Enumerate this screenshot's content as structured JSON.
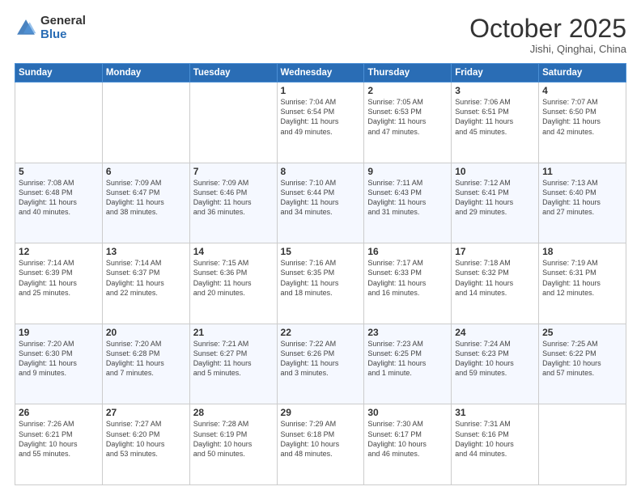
{
  "logo": {
    "general": "General",
    "blue": "Blue"
  },
  "header": {
    "month": "October 2025",
    "location": "Jishi, Qinghai, China"
  },
  "days_of_week": [
    "Sunday",
    "Monday",
    "Tuesday",
    "Wednesday",
    "Thursday",
    "Friday",
    "Saturday"
  ],
  "weeks": [
    [
      {
        "day": "",
        "info": ""
      },
      {
        "day": "",
        "info": ""
      },
      {
        "day": "",
        "info": ""
      },
      {
        "day": "1",
        "info": "Sunrise: 7:04 AM\nSunset: 6:54 PM\nDaylight: 11 hours\nand 49 minutes."
      },
      {
        "day": "2",
        "info": "Sunrise: 7:05 AM\nSunset: 6:53 PM\nDaylight: 11 hours\nand 47 minutes."
      },
      {
        "day": "3",
        "info": "Sunrise: 7:06 AM\nSunset: 6:51 PM\nDaylight: 11 hours\nand 45 minutes."
      },
      {
        "day": "4",
        "info": "Sunrise: 7:07 AM\nSunset: 6:50 PM\nDaylight: 11 hours\nand 42 minutes."
      }
    ],
    [
      {
        "day": "5",
        "info": "Sunrise: 7:08 AM\nSunset: 6:48 PM\nDaylight: 11 hours\nand 40 minutes."
      },
      {
        "day": "6",
        "info": "Sunrise: 7:09 AM\nSunset: 6:47 PM\nDaylight: 11 hours\nand 38 minutes."
      },
      {
        "day": "7",
        "info": "Sunrise: 7:09 AM\nSunset: 6:46 PM\nDaylight: 11 hours\nand 36 minutes."
      },
      {
        "day": "8",
        "info": "Sunrise: 7:10 AM\nSunset: 6:44 PM\nDaylight: 11 hours\nand 34 minutes."
      },
      {
        "day": "9",
        "info": "Sunrise: 7:11 AM\nSunset: 6:43 PM\nDaylight: 11 hours\nand 31 minutes."
      },
      {
        "day": "10",
        "info": "Sunrise: 7:12 AM\nSunset: 6:41 PM\nDaylight: 11 hours\nand 29 minutes."
      },
      {
        "day": "11",
        "info": "Sunrise: 7:13 AM\nSunset: 6:40 PM\nDaylight: 11 hours\nand 27 minutes."
      }
    ],
    [
      {
        "day": "12",
        "info": "Sunrise: 7:14 AM\nSunset: 6:39 PM\nDaylight: 11 hours\nand 25 minutes."
      },
      {
        "day": "13",
        "info": "Sunrise: 7:14 AM\nSunset: 6:37 PM\nDaylight: 11 hours\nand 22 minutes."
      },
      {
        "day": "14",
        "info": "Sunrise: 7:15 AM\nSunset: 6:36 PM\nDaylight: 11 hours\nand 20 minutes."
      },
      {
        "day": "15",
        "info": "Sunrise: 7:16 AM\nSunset: 6:35 PM\nDaylight: 11 hours\nand 18 minutes."
      },
      {
        "day": "16",
        "info": "Sunrise: 7:17 AM\nSunset: 6:33 PM\nDaylight: 11 hours\nand 16 minutes."
      },
      {
        "day": "17",
        "info": "Sunrise: 7:18 AM\nSunset: 6:32 PM\nDaylight: 11 hours\nand 14 minutes."
      },
      {
        "day": "18",
        "info": "Sunrise: 7:19 AM\nSunset: 6:31 PM\nDaylight: 11 hours\nand 12 minutes."
      }
    ],
    [
      {
        "day": "19",
        "info": "Sunrise: 7:20 AM\nSunset: 6:30 PM\nDaylight: 11 hours\nand 9 minutes."
      },
      {
        "day": "20",
        "info": "Sunrise: 7:20 AM\nSunset: 6:28 PM\nDaylight: 11 hours\nand 7 minutes."
      },
      {
        "day": "21",
        "info": "Sunrise: 7:21 AM\nSunset: 6:27 PM\nDaylight: 11 hours\nand 5 minutes."
      },
      {
        "day": "22",
        "info": "Sunrise: 7:22 AM\nSunset: 6:26 PM\nDaylight: 11 hours\nand 3 minutes."
      },
      {
        "day": "23",
        "info": "Sunrise: 7:23 AM\nSunset: 6:25 PM\nDaylight: 11 hours\nand 1 minute."
      },
      {
        "day": "24",
        "info": "Sunrise: 7:24 AM\nSunset: 6:23 PM\nDaylight: 10 hours\nand 59 minutes."
      },
      {
        "day": "25",
        "info": "Sunrise: 7:25 AM\nSunset: 6:22 PM\nDaylight: 10 hours\nand 57 minutes."
      }
    ],
    [
      {
        "day": "26",
        "info": "Sunrise: 7:26 AM\nSunset: 6:21 PM\nDaylight: 10 hours\nand 55 minutes."
      },
      {
        "day": "27",
        "info": "Sunrise: 7:27 AM\nSunset: 6:20 PM\nDaylight: 10 hours\nand 53 minutes."
      },
      {
        "day": "28",
        "info": "Sunrise: 7:28 AM\nSunset: 6:19 PM\nDaylight: 10 hours\nand 50 minutes."
      },
      {
        "day": "29",
        "info": "Sunrise: 7:29 AM\nSunset: 6:18 PM\nDaylight: 10 hours\nand 48 minutes."
      },
      {
        "day": "30",
        "info": "Sunrise: 7:30 AM\nSunset: 6:17 PM\nDaylight: 10 hours\nand 46 minutes."
      },
      {
        "day": "31",
        "info": "Sunrise: 7:31 AM\nSunset: 6:16 PM\nDaylight: 10 hours\nand 44 minutes."
      },
      {
        "day": "",
        "info": ""
      }
    ]
  ]
}
